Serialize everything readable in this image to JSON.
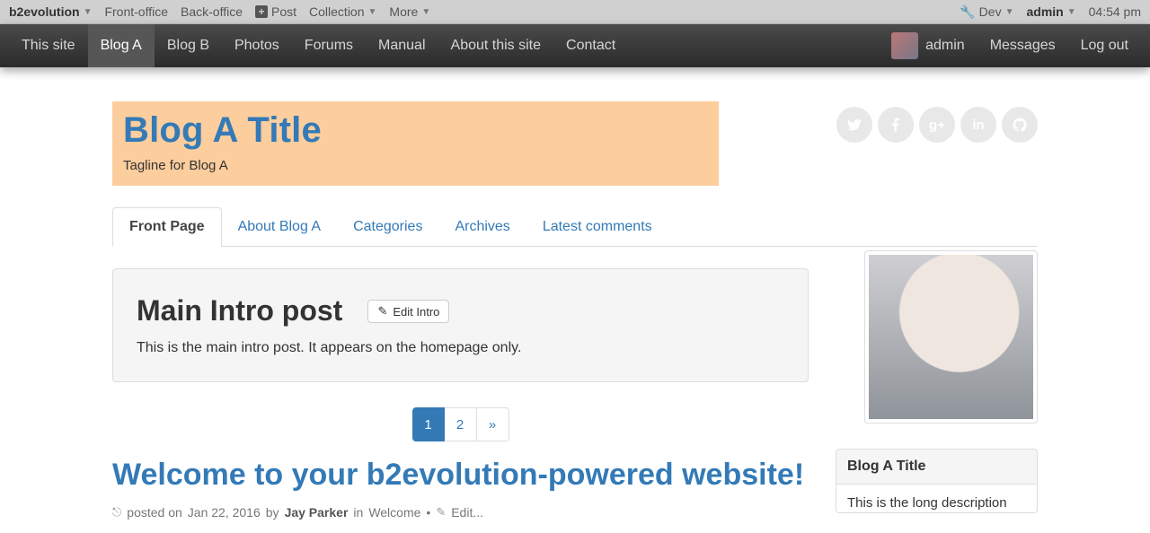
{
  "evobar": {
    "brand": "b2evolution",
    "left": [
      "Front-office",
      "Back-office"
    ],
    "post": "Post",
    "collection": "Collection",
    "more": "More",
    "dev": "Dev",
    "admin": "admin",
    "time": "04:54 pm"
  },
  "sitenav": {
    "items": [
      "This site",
      "Blog A",
      "Blog B",
      "Photos",
      "Forums",
      "Manual",
      "About this site",
      "Contact"
    ],
    "active_index": 1,
    "right": {
      "user": "admin",
      "messages": "Messages",
      "logout": "Log out"
    }
  },
  "header": {
    "title": "Blog A Title",
    "tagline": "Tagline for Blog A"
  },
  "social": [
    "twitter",
    "facebook",
    "googleplus",
    "linkedin",
    "github"
  ],
  "tabs": {
    "items": [
      "Front Page",
      "About Blog A",
      "Categories",
      "Archives",
      "Latest comments"
    ],
    "active_index": 0
  },
  "intro": {
    "title": "Main Intro post",
    "edit_label": "Edit Intro",
    "body": "This is the main intro post. It appears on the homepage only."
  },
  "pager": {
    "pages": [
      "1",
      "2"
    ],
    "active_index": 0
  },
  "post": {
    "title": "Welcome to your b2evolution-powered website!",
    "meta_prefix": "posted on ",
    "date": "Jan 22, 2016",
    "by": " by ",
    "author": "Jay Parker",
    "in": " in ",
    "category": "Welcome",
    "dot": " • ",
    "edit": "Edit..."
  },
  "sidebar": {
    "widget_title": "Blog A Title",
    "widget_body": "This is the long description"
  }
}
